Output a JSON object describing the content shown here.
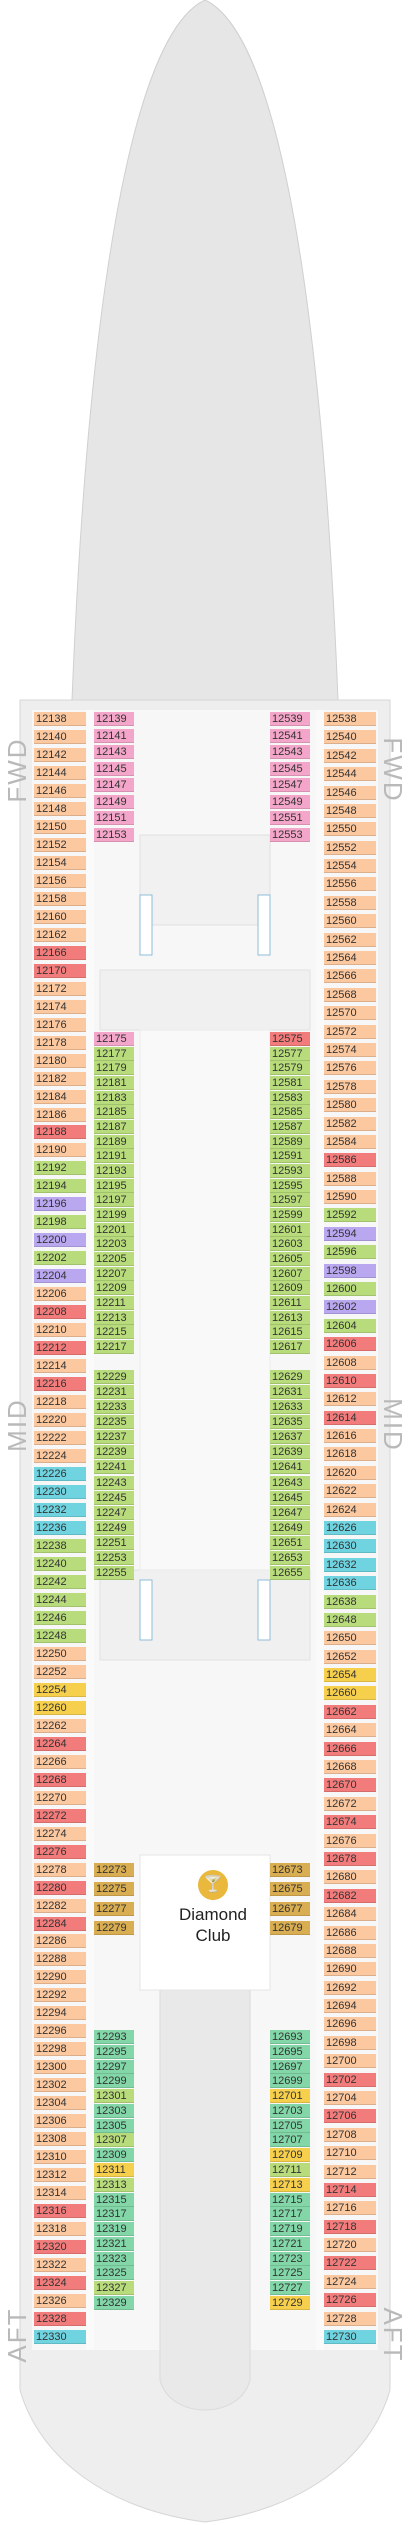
{
  "labels": {
    "fwd": "FWD",
    "mid": "MID",
    "aft": "AFT"
  },
  "venue": {
    "name_line1": "Diamond",
    "name_line2": "Club",
    "icon": "cocktail-icon"
  },
  "colors": {
    "orange": "#fbc8a0",
    "pink": "#f3a6c9",
    "green": "#b8dc7c",
    "red": "#f27c7c",
    "teal": "#6fd3e0",
    "purple": "#b9a7f0",
    "yellow": "#f6d04d",
    "gold": "#d9ad52",
    "mint": "#82d6a7",
    "hull": "#ececec",
    "deck": "#f6f6f6"
  },
  "cabins": {
    "outer_left": [
      [
        "12138",
        "orange"
      ],
      [
        "12140",
        "orange"
      ],
      [
        "12142",
        "orange"
      ],
      [
        "12144",
        "orange"
      ],
      [
        "12146",
        "orange"
      ],
      [
        "12148",
        "orange"
      ],
      [
        "12150",
        "orange"
      ],
      [
        "12152",
        "orange"
      ],
      [
        "12154",
        "orange"
      ],
      [
        "12156",
        "orange"
      ],
      [
        "12158",
        "orange"
      ],
      [
        "12160",
        "orange"
      ],
      [
        "12162",
        "orange"
      ],
      [
        "12166",
        "red"
      ],
      [
        "12170",
        "red"
      ],
      [
        "12172",
        "orange"
      ],
      [
        "12174",
        "orange"
      ],
      [
        "12176",
        "orange"
      ],
      [
        "12178",
        "orange"
      ],
      [
        "12180",
        "orange"
      ],
      [
        "12182",
        "orange"
      ],
      [
        "12184",
        "orange"
      ],
      [
        "12186",
        "orange"
      ],
      [
        "12188",
        "red"
      ],
      [
        "12190",
        "orange"
      ],
      [
        "12192",
        "green"
      ],
      [
        "12194",
        "green"
      ],
      [
        "12196",
        "purple"
      ],
      [
        "12198",
        "green"
      ],
      [
        "12200",
        "purple"
      ],
      [
        "12202",
        "green"
      ],
      [
        "12204",
        "purple"
      ],
      [
        "12206",
        "orange"
      ],
      [
        "12208",
        "red"
      ],
      [
        "12210",
        "orange"
      ],
      [
        "12212",
        "red"
      ],
      [
        "12214",
        "orange"
      ],
      [
        "12216",
        "red"
      ],
      [
        "12218",
        "orange"
      ],
      [
        "12220",
        "orange"
      ],
      [
        "12222",
        "orange"
      ],
      [
        "12224",
        "orange"
      ],
      [
        "12226",
        "teal"
      ],
      [
        "12230",
        "teal"
      ],
      [
        "12232",
        "teal"
      ],
      [
        "12236",
        "teal"
      ],
      [
        "12238",
        "green"
      ],
      [
        "12240",
        "green"
      ],
      [
        "12242",
        "green"
      ],
      [
        "12244",
        "green"
      ],
      [
        "12246",
        "green"
      ],
      [
        "12248",
        "green"
      ],
      [
        "12250",
        "orange"
      ],
      [
        "12252",
        "orange"
      ],
      [
        "12254",
        "yellow"
      ],
      [
        "12260",
        "yellow"
      ],
      [
        "12262",
        "orange"
      ],
      [
        "12264",
        "red"
      ],
      [
        "12266",
        "orange"
      ],
      [
        "12268",
        "red"
      ],
      [
        "12270",
        "orange"
      ],
      [
        "12272",
        "red"
      ],
      [
        "12274",
        "orange"
      ],
      [
        "12276",
        "red"
      ],
      [
        "12278",
        "orange"
      ],
      [
        "12280",
        "red"
      ],
      [
        "12282",
        "orange"
      ],
      [
        "12284",
        "red"
      ],
      [
        "12286",
        "orange"
      ],
      [
        "12288",
        "orange"
      ],
      [
        "12290",
        "orange"
      ],
      [
        "12292",
        "orange"
      ],
      [
        "12294",
        "orange"
      ],
      [
        "12296",
        "orange"
      ],
      [
        "12298",
        "orange"
      ],
      [
        "12300",
        "orange"
      ],
      [
        "12302",
        "orange"
      ],
      [
        "12304",
        "orange"
      ],
      [
        "12306",
        "orange"
      ],
      [
        "12308",
        "orange"
      ],
      [
        "12310",
        "orange"
      ],
      [
        "12312",
        "orange"
      ],
      [
        "12314",
        "orange"
      ],
      [
        "12316",
        "red"
      ],
      [
        "12318",
        "orange"
      ],
      [
        "12320",
        "red"
      ],
      [
        "12322",
        "orange"
      ],
      [
        "12324",
        "red"
      ],
      [
        "12326",
        "orange"
      ],
      [
        "12328",
        "red"
      ],
      [
        "12330",
        "teal"
      ]
    ],
    "outer_right": [
      [
        "12538",
        "orange"
      ],
      [
        "12540",
        "orange"
      ],
      [
        "12542",
        "orange"
      ],
      [
        "12544",
        "orange"
      ],
      [
        "12546",
        "orange"
      ],
      [
        "12548",
        "orange"
      ],
      [
        "12550",
        "orange"
      ],
      [
        "12552",
        "orange"
      ],
      [
        "12554",
        "orange"
      ],
      [
        "12556",
        "orange"
      ],
      [
        "12558",
        "orange"
      ],
      [
        "12560",
        "orange"
      ],
      [
        "12562",
        "orange"
      ],
      [
        "12564",
        "orange"
      ],
      [
        "12566",
        "orange"
      ],
      [
        "12568",
        "orange"
      ],
      [
        "12570",
        "orange"
      ],
      [
        "12572",
        "orange"
      ],
      [
        "12574",
        "orange"
      ],
      [
        "12576",
        "orange"
      ],
      [
        "12578",
        "orange"
      ],
      [
        "12580",
        "orange"
      ],
      [
        "12582",
        "orange"
      ],
      [
        "12584",
        "orange"
      ],
      [
        "12586",
        "red"
      ],
      [
        "12588",
        "orange"
      ],
      [
        "12590",
        "orange"
      ],
      [
        "12592",
        "green"
      ],
      [
        "12594",
        "purple"
      ],
      [
        "12596",
        "green"
      ],
      [
        "12598",
        "purple"
      ],
      [
        "12600",
        "green"
      ],
      [
        "12602",
        "purple"
      ],
      [
        "12604",
        "green"
      ],
      [
        "12606",
        "red"
      ],
      [
        "12608",
        "orange"
      ],
      [
        "12610",
        "red"
      ],
      [
        "12612",
        "orange"
      ],
      [
        "12614",
        "red"
      ],
      [
        "12616",
        "orange"
      ],
      [
        "12618",
        "orange"
      ],
      [
        "12620",
        "orange"
      ],
      [
        "12622",
        "orange"
      ],
      [
        "12624",
        "orange"
      ],
      [
        "12626",
        "teal"
      ],
      [
        "12630",
        "teal"
      ],
      [
        "12632",
        "teal"
      ],
      [
        "12636",
        "teal"
      ],
      [
        "12638",
        "green"
      ],
      [
        "12648",
        "green"
      ],
      [
        "12650",
        "orange"
      ],
      [
        "12652",
        "orange"
      ],
      [
        "12654",
        "yellow"
      ],
      [
        "12660",
        "yellow"
      ],
      [
        "12662",
        "red"
      ],
      [
        "12664",
        "orange"
      ],
      [
        "12666",
        "red"
      ],
      [
        "12668",
        "orange"
      ],
      [
        "12670",
        "red"
      ],
      [
        "12672",
        "orange"
      ],
      [
        "12674",
        "red"
      ],
      [
        "12676",
        "orange"
      ],
      [
        "12678",
        "red"
      ],
      [
        "12680",
        "orange"
      ],
      [
        "12682",
        "red"
      ],
      [
        "12684",
        "orange"
      ],
      [
        "12686",
        "orange"
      ],
      [
        "12688",
        "orange"
      ],
      [
        "12690",
        "orange"
      ],
      [
        "12692",
        "orange"
      ],
      [
        "12694",
        "orange"
      ],
      [
        "12696",
        "orange"
      ],
      [
        "12698",
        "orange"
      ],
      [
        "12700",
        "orange"
      ],
      [
        "12702",
        "red"
      ],
      [
        "12704",
        "orange"
      ],
      [
        "12706",
        "red"
      ],
      [
        "12708",
        "orange"
      ],
      [
        "12710",
        "orange"
      ],
      [
        "12712",
        "orange"
      ],
      [
        "12714",
        "red"
      ],
      [
        "12716",
        "orange"
      ],
      [
        "12718",
        "red"
      ],
      [
        "12720",
        "orange"
      ],
      [
        "12722",
        "red"
      ],
      [
        "12724",
        "orange"
      ],
      [
        "12726",
        "red"
      ],
      [
        "12728",
        "orange"
      ],
      [
        "12730",
        "teal"
      ]
    ],
    "inner_left_fwd": [
      [
        "12139",
        "pink"
      ],
      [
        "12141",
        "pink"
      ],
      [
        "12143",
        "pink"
      ],
      [
        "12145",
        "pink"
      ],
      [
        "12147",
        "pink"
      ],
      [
        "12149",
        "pink"
      ],
      [
        "12151",
        "pink"
      ],
      [
        "12153",
        "pink"
      ]
    ],
    "inner_right_fwd": [
      [
        "12539",
        "pink"
      ],
      [
        "12541",
        "pink"
      ],
      [
        "12543",
        "pink"
      ],
      [
        "12545",
        "pink"
      ],
      [
        "12547",
        "pink"
      ],
      [
        "12549",
        "pink"
      ],
      [
        "12551",
        "pink"
      ],
      [
        "12553",
        "pink"
      ]
    ],
    "inner_left_mid": [
      [
        "12175",
        "pink"
      ],
      [
        "12177",
        "green"
      ],
      [
        "12179",
        "green"
      ],
      [
        "12181",
        "green"
      ],
      [
        "12183",
        "green"
      ],
      [
        "12185",
        "green"
      ],
      [
        "12187",
        "green"
      ],
      [
        "12189",
        "green"
      ],
      [
        "12191",
        "green"
      ],
      [
        "12193",
        "green"
      ],
      [
        "12195",
        "green"
      ],
      [
        "12197",
        "green"
      ],
      [
        "12199",
        "green"
      ],
      [
        "12201",
        "green"
      ],
      [
        "12203",
        "green"
      ],
      [
        "12205",
        "green"
      ],
      [
        "12207",
        "green"
      ],
      [
        "12209",
        "green"
      ],
      [
        "12211",
        "green"
      ],
      [
        "12213",
        "green"
      ],
      [
        "12215",
        "green"
      ],
      [
        "12217",
        "green"
      ]
    ],
    "inner_right_mid": [
      [
        "12575",
        "red"
      ],
      [
        "12577",
        "green"
      ],
      [
        "12579",
        "green"
      ],
      [
        "12581",
        "green"
      ],
      [
        "12583",
        "green"
      ],
      [
        "12585",
        "green"
      ],
      [
        "12587",
        "green"
      ],
      [
        "12589",
        "green"
      ],
      [
        "12591",
        "green"
      ],
      [
        "12593",
        "green"
      ],
      [
        "12595",
        "green"
      ],
      [
        "12597",
        "green"
      ],
      [
        "12599",
        "green"
      ],
      [
        "12601",
        "green"
      ],
      [
        "12603",
        "green"
      ],
      [
        "12605",
        "green"
      ],
      [
        "12607",
        "green"
      ],
      [
        "12609",
        "green"
      ],
      [
        "12611",
        "green"
      ],
      [
        "12613",
        "green"
      ],
      [
        "12615",
        "green"
      ],
      [
        "12617",
        "green"
      ]
    ],
    "inner_left_mid2": [
      [
        "12229",
        "green"
      ],
      [
        "12231",
        "green"
      ],
      [
        "12233",
        "green"
      ],
      [
        "12235",
        "green"
      ],
      [
        "12237",
        "green"
      ],
      [
        "12239",
        "green"
      ],
      [
        "12241",
        "green"
      ],
      [
        "12243",
        "green"
      ],
      [
        "12245",
        "green"
      ],
      [
        "12247",
        "green"
      ],
      [
        "12249",
        "green"
      ],
      [
        "12251",
        "green"
      ],
      [
        "12253",
        "green"
      ],
      [
        "12255",
        "green"
      ]
    ],
    "inner_right_mid2": [
      [
        "12629",
        "green"
      ],
      [
        "12631",
        "green"
      ],
      [
        "12633",
        "green"
      ],
      [
        "12635",
        "green"
      ],
      [
        "12637",
        "green"
      ],
      [
        "12639",
        "green"
      ],
      [
        "12641",
        "green"
      ],
      [
        "12643",
        "green"
      ],
      [
        "12645",
        "green"
      ],
      [
        "12647",
        "green"
      ],
      [
        "12649",
        "green"
      ],
      [
        "12651",
        "green"
      ],
      [
        "12653",
        "green"
      ],
      [
        "12655",
        "green"
      ]
    ],
    "inner_left_club": [
      [
        "12273",
        "gold"
      ],
      [
        "12275",
        "gold"
      ],
      [
        "12277",
        "gold"
      ],
      [
        "12279",
        "gold"
      ]
    ],
    "inner_right_club": [
      [
        "12673",
        "gold"
      ],
      [
        "12675",
        "gold"
      ],
      [
        "12677",
        "gold"
      ],
      [
        "12679",
        "gold"
      ]
    ],
    "inner_left_aft": [
      [
        "12293",
        "mint"
      ],
      [
        "12295",
        "mint"
      ],
      [
        "12297",
        "mint"
      ],
      [
        "12299",
        "mint"
      ],
      [
        "12301",
        "green"
      ],
      [
        "12303",
        "mint"
      ],
      [
        "12305",
        "mint"
      ],
      [
        "12307",
        "green"
      ],
      [
        "12309",
        "mint"
      ],
      [
        "12311",
        "yellow"
      ],
      [
        "12313",
        "green"
      ],
      [
        "12315",
        "mint"
      ],
      [
        "12317",
        "mint"
      ],
      [
        "12319",
        "mint"
      ],
      [
        "12321",
        "mint"
      ],
      [
        "12323",
        "mint"
      ],
      [
        "12325",
        "mint"
      ],
      [
        "12327",
        "green"
      ],
      [
        "12329",
        "mint"
      ]
    ],
    "inner_right_aft": [
      [
        "12693",
        "mint"
      ],
      [
        "12695",
        "mint"
      ],
      [
        "12697",
        "mint"
      ],
      [
        "12699",
        "mint"
      ],
      [
        "12701",
        "yellow"
      ],
      [
        "12703",
        "mint"
      ],
      [
        "12705",
        "mint"
      ],
      [
        "12707",
        "mint"
      ],
      [
        "12709",
        "yellow"
      ],
      [
        "12711",
        "green"
      ],
      [
        "12713",
        "yellow"
      ],
      [
        "12715",
        "mint"
      ],
      [
        "12717",
        "mint"
      ],
      [
        "12719",
        "mint"
      ],
      [
        "12721",
        "mint"
      ],
      [
        "12723",
        "mint"
      ],
      [
        "12725",
        "mint"
      ],
      [
        "12727",
        "mint"
      ],
      [
        "12729",
        "yellow"
      ]
    ]
  }
}
